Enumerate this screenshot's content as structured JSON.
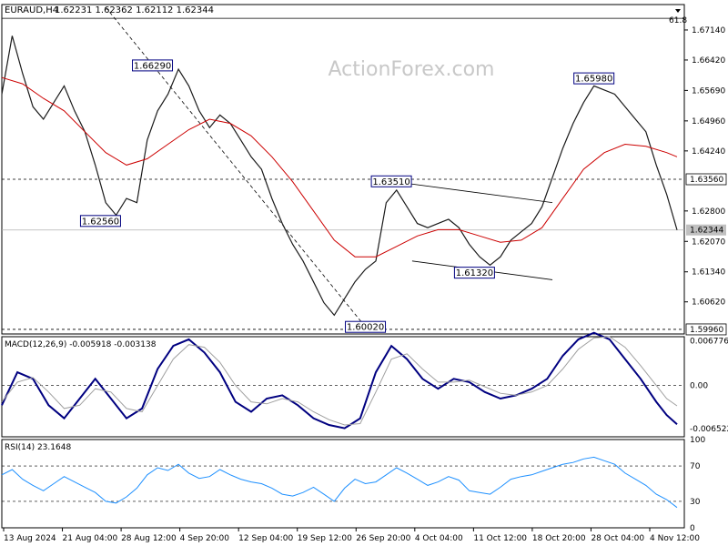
{
  "header": {
    "symbol": "EURAUD,H4",
    "ohlc": "1.62231 1.62362 1.62112 1.62344"
  },
  "watermark": "ActionForex.com",
  "fib_label": "61.8",
  "colors": {
    "price": "#1a1a1a",
    "sma": "#cc0000",
    "macd": "#000080",
    "signal": "#a0a0a0",
    "rsi": "#1e90ff",
    "current_price_box": "#c0c0c0"
  },
  "chart_data": [
    {
      "type": "line",
      "panel": "price",
      "ylim": [
        1.5985,
        1.6775
      ],
      "x_ticks": [
        "13 Aug 2024",
        "21 Aug 04:00",
        "28 Aug 12:00",
        "4 Sep 20:00",
        "12 Sep 04:00",
        "19 Sep 12:00",
        "26 Sep 20:00",
        "4 Oct 04:00",
        "11 Oct 12:00",
        "18 Oct 20:00",
        "28 Oct 04:00",
        "4 Nov 12:00"
      ],
      "y_ticks": [
        "1.67140",
        "1.66420",
        "1.65690",
        "1.64960",
        "1.64240",
        "1.62800",
        "1.62070",
        "1.61340",
        "1.60620"
      ],
      "level_labels": {
        "upper": "1.63560",
        "current": "1.62344",
        "lower": "1.59960"
      },
      "levels": {
        "upper": 1.6356,
        "current": 1.62344,
        "lower": 1.5996,
        "fib": 1.6742
      },
      "annotations": [
        {
          "text": "1.66290",
          "x": 29,
          "y": 1.6629
        },
        {
          "text": "1.62560",
          "x": 19,
          "y": 1.6256
        },
        {
          "text": "1.63510",
          "x": 75,
          "y": 1.6351
        },
        {
          "text": "1.60020",
          "x": 70,
          "y": 1.6002
        },
        {
          "text": "1.61320",
          "x": 91,
          "y": 1.6132
        },
        {
          "text": "1.65980",
          "x": 114,
          "y": 1.6598
        }
      ],
      "series": [
        {
          "key": "close",
          "x": [
            0,
            2,
            4,
            6,
            8,
            10,
            12,
            14,
            16,
            18,
            20,
            22,
            24,
            26,
            28,
            30,
            32,
            34,
            36,
            38,
            40,
            42,
            44,
            46,
            48,
            50,
            52,
            54,
            56,
            58,
            60,
            62,
            64,
            66,
            68,
            70,
            72,
            74,
            76,
            78,
            80,
            82,
            84,
            86,
            88,
            90,
            92,
            94,
            96,
            98,
            100,
            102,
            104,
            106,
            108,
            110,
            112,
            114,
            116,
            118,
            120,
            122,
            124,
            126,
            128,
            130
          ],
          "values": [
            1.656,
            1.67,
            1.661,
            1.653,
            1.65,
            1.654,
            1.658,
            1.652,
            1.647,
            1.639,
            1.63,
            1.627,
            1.631,
            1.63,
            1.645,
            1.652,
            1.656,
            1.662,
            1.658,
            1.652,
            1.648,
            1.651,
            1.649,
            1.645,
            1.641,
            1.638,
            1.631,
            1.625,
            1.62,
            1.616,
            1.611,
            1.606,
            1.603,
            1.607,
            1.611,
            1.614,
            1.616,
            1.63,
            1.633,
            1.629,
            1.625,
            1.624,
            1.625,
            1.626,
            1.624,
            1.62,
            1.617,
            1.615,
            1.617,
            1.621,
            1.623,
            1.625,
            1.629,
            1.636,
            1.643,
            1.649,
            1.654,
            1.658,
            1.657,
            1.656,
            1.653,
            1.65,
            1.647,
            1.639,
            1.632,
            1.62344
          ]
        },
        {
          "key": "sma",
          "x": [
            0,
            4,
            8,
            12,
            16,
            20,
            24,
            28,
            32,
            36,
            40,
            44,
            48,
            52,
            56,
            60,
            64,
            68,
            72,
            76,
            80,
            84,
            88,
            92,
            96,
            100,
            104,
            108,
            112,
            116,
            120,
            124,
            128,
            130
          ],
          "values": [
            1.66,
            1.6585,
            1.655,
            1.652,
            1.647,
            1.642,
            1.639,
            1.6405,
            1.644,
            1.6475,
            1.65,
            1.649,
            1.646,
            1.641,
            1.635,
            1.628,
            1.621,
            1.617,
            1.617,
            1.6195,
            1.622,
            1.6235,
            1.6235,
            1.622,
            1.6205,
            1.621,
            1.624,
            1.631,
            1.638,
            1.642,
            1.644,
            1.6435,
            1.642,
            1.641
          ]
        }
      ]
    },
    {
      "type": "line",
      "panel": "macd",
      "title": "MACD(12,26,9) -0.005918 -0.003138",
      "ylim": [
        -0.0078,
        0.0074
      ],
      "y_ticks": [
        "0.006776",
        "0.00",
        "-0.006522"
      ],
      "series": [
        {
          "key": "macd",
          "x": [
            0,
            3,
            6,
            9,
            12,
            15,
            18,
            21,
            24,
            27,
            30,
            33,
            36,
            39,
            42,
            45,
            48,
            51,
            54,
            57,
            60,
            63,
            66,
            69,
            72,
            75,
            78,
            81,
            84,
            87,
            90,
            93,
            96,
            99,
            102,
            105,
            108,
            111,
            114,
            117,
            120,
            123,
            126,
            128,
            130
          ],
          "values": [
            -0.003,
            0.002,
            0.001,
            -0.003,
            -0.005,
            -0.002,
            0.001,
            -0.002,
            -0.005,
            -0.0035,
            0.0025,
            0.006,
            0.007,
            0.005,
            0.002,
            -0.0025,
            -0.004,
            -0.002,
            -0.0015,
            -0.003,
            -0.005,
            -0.006,
            -0.0065,
            -0.005,
            0.002,
            0.006,
            0.004,
            0.001,
            -0.0005,
            0.001,
            0.0005,
            -0.001,
            -0.002,
            -0.0015,
            -0.0005,
            0.001,
            0.0045,
            0.007,
            0.008,
            0.007,
            0.004,
            0.001,
            -0.0025,
            -0.0045,
            -0.0059
          ]
        },
        {
          "key": "signal",
          "x": [
            0,
            3,
            6,
            9,
            12,
            15,
            18,
            21,
            24,
            27,
            30,
            33,
            36,
            39,
            42,
            45,
            48,
            51,
            54,
            57,
            60,
            63,
            66,
            69,
            72,
            75,
            78,
            81,
            84,
            87,
            90,
            93,
            96,
            99,
            102,
            105,
            108,
            111,
            114,
            117,
            120,
            123,
            126,
            128,
            130
          ],
          "values": [
            -0.0025,
            0.0005,
            0.0012,
            -0.001,
            -0.0035,
            -0.003,
            -0.0005,
            -0.001,
            -0.0035,
            -0.004,
            0.0,
            0.004,
            0.0062,
            0.0058,
            0.0035,
            0.0,
            -0.0025,
            -0.0028,
            -0.002,
            -0.0025,
            -0.004,
            -0.0052,
            -0.006,
            -0.0058,
            -0.001,
            0.004,
            0.0048,
            0.0025,
            0.0005,
            0.0005,
            0.0008,
            -0.0002,
            -0.0012,
            -0.0015,
            -0.001,
            0.0,
            0.0025,
            0.0055,
            0.0072,
            0.0074,
            0.0058,
            0.003,
            0.0,
            -0.002,
            -0.0031
          ]
        }
      ]
    },
    {
      "type": "line",
      "panel": "rsi",
      "title": "RSI(14) 23.1648",
      "ylim": [
        0,
        100
      ],
      "y_ticks": [
        "100",
        "70",
        "30",
        "0"
      ],
      "levels": [
        70,
        30
      ],
      "series": [
        {
          "key": "rsi",
          "x": [
            0,
            2,
            4,
            6,
            8,
            10,
            12,
            14,
            16,
            18,
            20,
            22,
            24,
            26,
            28,
            30,
            32,
            34,
            36,
            38,
            40,
            42,
            44,
            46,
            48,
            50,
            52,
            54,
            56,
            58,
            60,
            62,
            64,
            66,
            68,
            70,
            72,
            74,
            76,
            78,
            80,
            82,
            84,
            86,
            88,
            90,
            92,
            94,
            96,
            98,
            100,
            102,
            104,
            106,
            108,
            110,
            112,
            114,
            116,
            118,
            120,
            122,
            124,
            126,
            128,
            130
          ],
          "values": [
            60,
            66,
            55,
            48,
            42,
            50,
            58,
            52,
            46,
            40,
            30,
            28,
            35,
            45,
            60,
            68,
            65,
            72,
            62,
            56,
            58,
            66,
            60,
            55,
            52,
            50,
            45,
            38,
            36,
            40,
            46,
            38,
            30,
            45,
            55,
            50,
            52,
            60,
            68,
            62,
            55,
            48,
            52,
            58,
            54,
            42,
            40,
            38,
            46,
            55,
            58,
            60,
            64,
            68,
            72,
            74,
            78,
            80,
            76,
            72,
            62,
            55,
            48,
            38,
            32,
            23
          ]
        }
      ]
    }
  ]
}
